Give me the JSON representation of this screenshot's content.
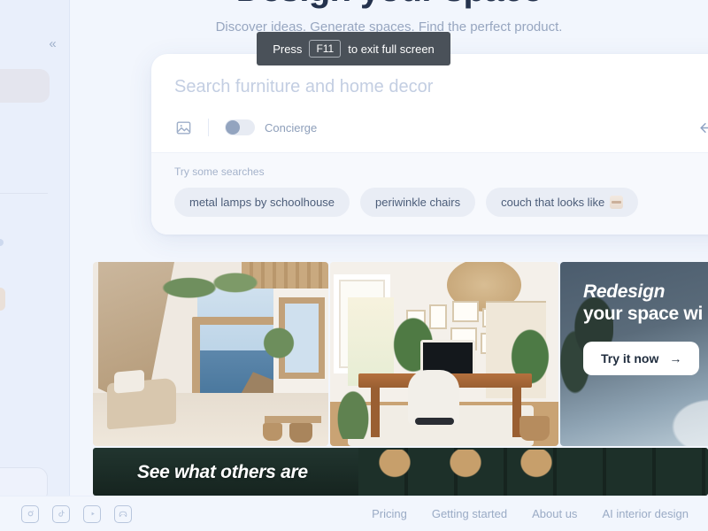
{
  "sidebar": {
    "collapse_icon": "«"
  },
  "hero": {
    "title": "Design your space",
    "subtitle": "Discover ideas. Generate spaces. Find the perfect product."
  },
  "search": {
    "placeholder": "Search furniture and home decor",
    "value": "",
    "image_search_icon": "image-search-icon",
    "concierge_label": "Concierge",
    "concierge_enabled": false,
    "submit_icon": "←",
    "suggestions_label": "Try some searches",
    "chips": [
      {
        "label": "metal lamps by schoolhouse",
        "emoji": false
      },
      {
        "label": "periwinkle chairs",
        "emoji": false
      },
      {
        "label": "couch that looks like",
        "emoji": true
      }
    ]
  },
  "gallery": {
    "cards": [
      {
        "name": "mediterranean-terrace"
      },
      {
        "name": "home-office-with-plants"
      }
    ],
    "promo": {
      "heading_line1": "Redesign",
      "heading_line2": "your space wi",
      "cta_label": "Try it now",
      "cta_arrow": "→"
    }
  },
  "bottom_banner": {
    "text": "See what others are"
  },
  "footer": {
    "social": [
      {
        "name": "instagram-icon",
        "glyph": "◎"
      },
      {
        "name": "tiktok-icon",
        "glyph": "♪"
      },
      {
        "name": "youtube-icon",
        "glyph": "▶"
      },
      {
        "name": "discord-icon",
        "glyph": "☻"
      }
    ],
    "links": [
      {
        "label": "Pricing"
      },
      {
        "label": "Getting started"
      },
      {
        "label": "About us"
      },
      {
        "label": "AI interior design"
      }
    ]
  },
  "fullscreen_tooltip": {
    "prefix": "Press",
    "key": "F11",
    "suffix": "to exit full screen"
  },
  "colors": {
    "background": "#f2f6fd",
    "sidebar": "#e9effb",
    "card": "#ffffff",
    "text": "#2e3c55",
    "muted": "#9aabc5",
    "chip": "#e9edf5",
    "tooltip": "#4a5159"
  }
}
